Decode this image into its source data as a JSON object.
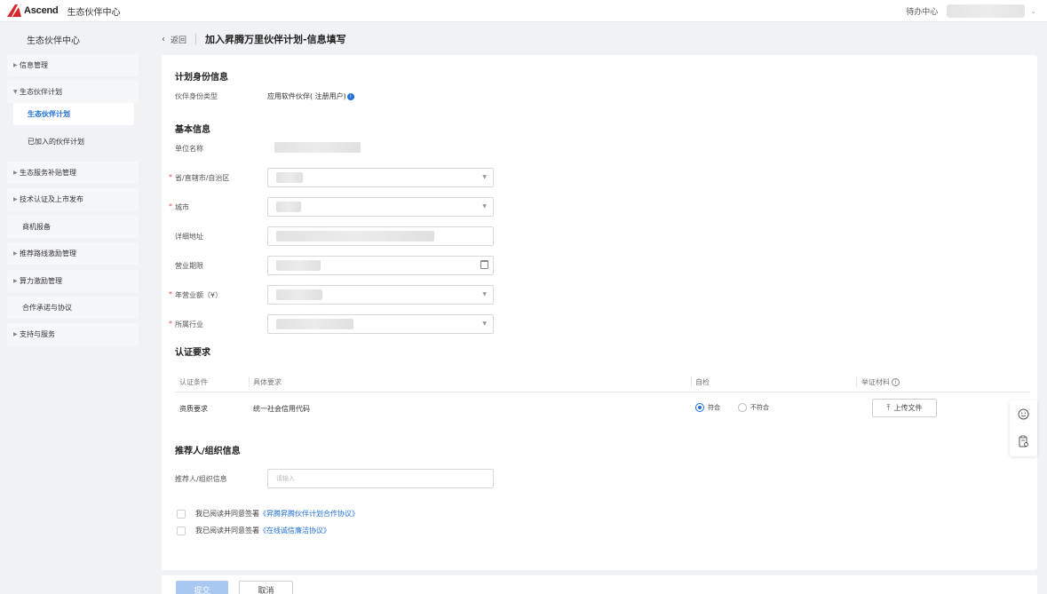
{
  "topbar": {
    "logo_text": "Ascend",
    "app_title": "生态伙伴中心",
    "todo": "待办中心"
  },
  "sidebar": {
    "title": "生态伙伴中心",
    "items": [
      {
        "label": "信息管理",
        "arrow": "▶"
      },
      {
        "label": "生态伙伴计划",
        "arrow": "▼"
      },
      {
        "label": "生态服务补贴管理",
        "arrow": "▶"
      },
      {
        "label": "技术认证及上市发布",
        "arrow": "▶"
      },
      {
        "label": "商机报备"
      },
      {
        "label": "推荐路线激励管理",
        "arrow": "▶"
      },
      {
        "label": "算力激励管理",
        "arrow": "▶"
      },
      {
        "label": "合作承诺与协议"
      },
      {
        "label": "支持与服务",
        "arrow": "▶"
      }
    ],
    "subitems": [
      {
        "label": "生态伙伴计划"
      },
      {
        "label": "已加入的伙伴计划"
      }
    ]
  },
  "header": {
    "back": "返回",
    "title": "加入昇腾万里伙伴计划-信息填写"
  },
  "sections": {
    "plan_identity": "计划身份信息",
    "basic_info": "基本信息",
    "cert_req": "认证要求",
    "referrer": "推荐人/组织信息"
  },
  "plan": {
    "type_label": "伙伴身份类型",
    "type_value": "应用软件伙伴( 注册用户)"
  },
  "basic": {
    "org_name": "单位名称",
    "province": "省/直辖市/自治区",
    "city": "城市",
    "address": "详细地址",
    "business_term": "营业期限",
    "revenue": "年营业额（¥）",
    "industry": "所属行业"
  },
  "cert_table": {
    "headers": [
      "认证条件",
      "具体要求",
      "自检",
      "举证材料"
    ],
    "rows": [
      {
        "condition": "资质要求",
        "requirement": "统一社会信用代码",
        "option_yes": "符合",
        "option_no": "不符合",
        "upload": "上传文件"
      }
    ]
  },
  "referrer": {
    "label": "推荐人/组织信息",
    "placeholder": "请输入"
  },
  "agreements": [
    {
      "prefix": "我已阅读并同意签署",
      "link": "《昇腾昇腾伙伴计划合作协议》"
    },
    {
      "prefix": "我已阅读并同意签署",
      "link": "《在线诚信廉洁协议》"
    }
  ],
  "footer": {
    "submit": "提交",
    "cancel": "取消"
  },
  "icons": {
    "back": "chevron-left-icon",
    "upload": "upload-icon",
    "info": "info-icon",
    "feedback": "smile-icon",
    "clipboard": "clipboard-icon"
  },
  "colors": {
    "primary": "#1f6fd6",
    "required": "#e34d4d",
    "disabled_primary": "#a9c8f1"
  }
}
